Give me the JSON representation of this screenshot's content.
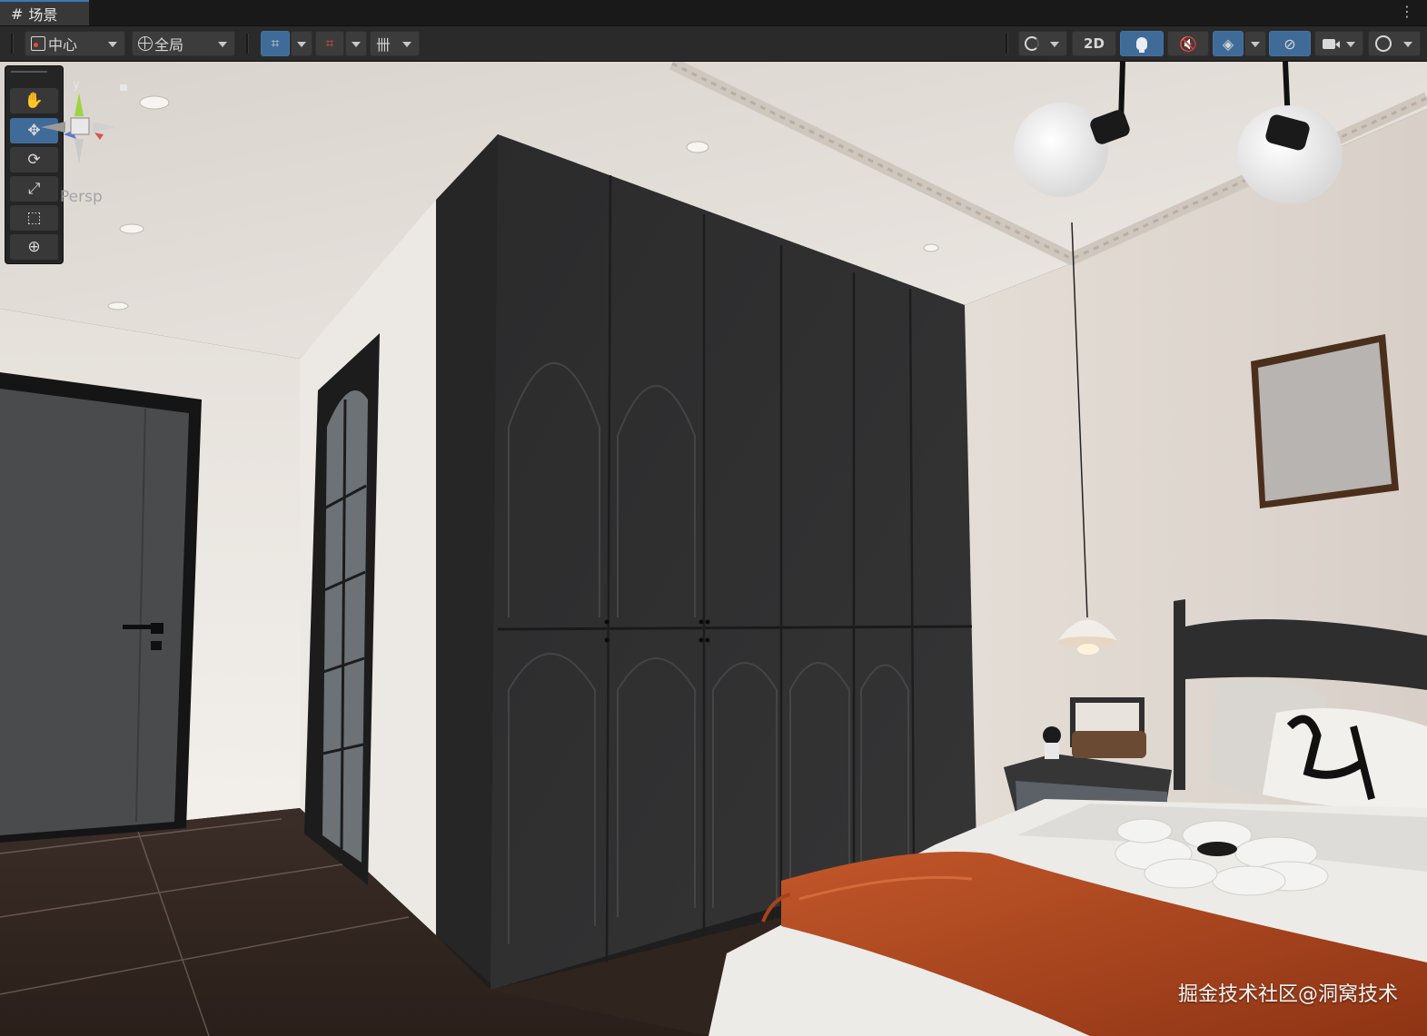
{
  "tab": {
    "icon": "grid-hash-icon",
    "title": "场景"
  },
  "toolbar": {
    "pivot_label": "中心",
    "space_label": "全局",
    "view_2d_label": "2D"
  },
  "viewport": {
    "projection_label": "Persp",
    "gizmo_axis_label": "y"
  },
  "tools": [
    "hand-tool",
    "move-tool",
    "rotate-tool",
    "scale-tool",
    "rect-tool",
    "transform-tool"
  ],
  "watermark": "掘金技术社区@洞窝技术",
  "colors": {
    "accent": "#3f6b99",
    "toolbar": "#2a2a2a",
    "wardrobe": "#2d2d2e",
    "blanket": "#b54b1e",
    "floor": "#3a2a24",
    "wall": "#e9e4df"
  }
}
